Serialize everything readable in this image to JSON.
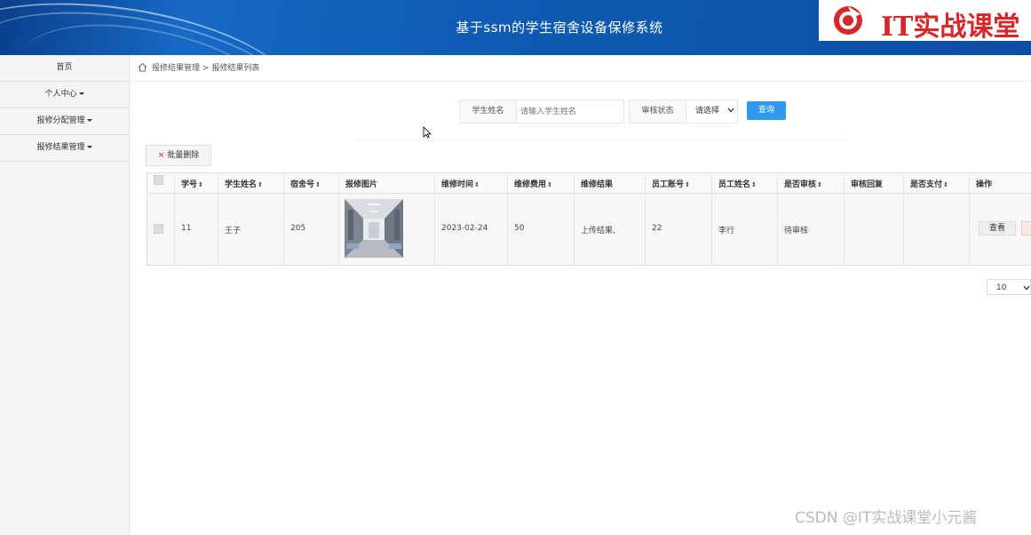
{
  "header": {
    "title": "基于ssm的学生宿舍设备保修系统",
    "brand_text": "IT实战课堂",
    "brand_color": "#d4282b",
    "gradient_color": "#0f5cb4"
  },
  "sidebar": {
    "items": [
      {
        "label": "首页",
        "has_caret": false
      },
      {
        "label": "个人中心",
        "has_caret": true
      },
      {
        "label": "报修分配管理",
        "has_caret": true
      },
      {
        "label": "报修结果管理",
        "has_caret": true
      }
    ]
  },
  "breadcrumb": {
    "icon": "home-icon",
    "parent": "报修结果管理",
    "separator": ">",
    "current": "报修结果列表"
  },
  "search": {
    "student_name_label": "学生姓名",
    "student_name_placeholder": "请输入学生姓名",
    "status_label": "审核状态",
    "status_value": "请选择",
    "search_button": "查询",
    "accent_color": "#2d9af0"
  },
  "toolbar": {
    "batch_delete_label": "批量删除"
  },
  "table": {
    "columns": [
      "学号",
      "学生姓名",
      "宿舍号",
      "报修图片",
      "维修时间",
      "维修费用",
      "维修结果",
      "员工账号",
      "员工姓名",
      "是否审核",
      "审核回复",
      "是否支付",
      "操作"
    ],
    "sortable": [
      true,
      true,
      true,
      false,
      true,
      true,
      false,
      true,
      true,
      true,
      false,
      true,
      false
    ],
    "rows": [
      {
        "student_id": "11",
        "student_name": "王子",
        "dorm_no": "205",
        "repair_image": "corridor-photo",
        "repair_time": "2023-02-24",
        "repair_cost": "50",
        "repair_result": "上传结果,",
        "staff_account": "22",
        "staff_name": "李行",
        "audit_status": "待审核",
        "audit_reply": "",
        "paid": "",
        "view_button": "查看"
      }
    ]
  },
  "pagination": {
    "page_size": "10"
  },
  "watermark": "CSDN @IT实战课堂小元酱"
}
